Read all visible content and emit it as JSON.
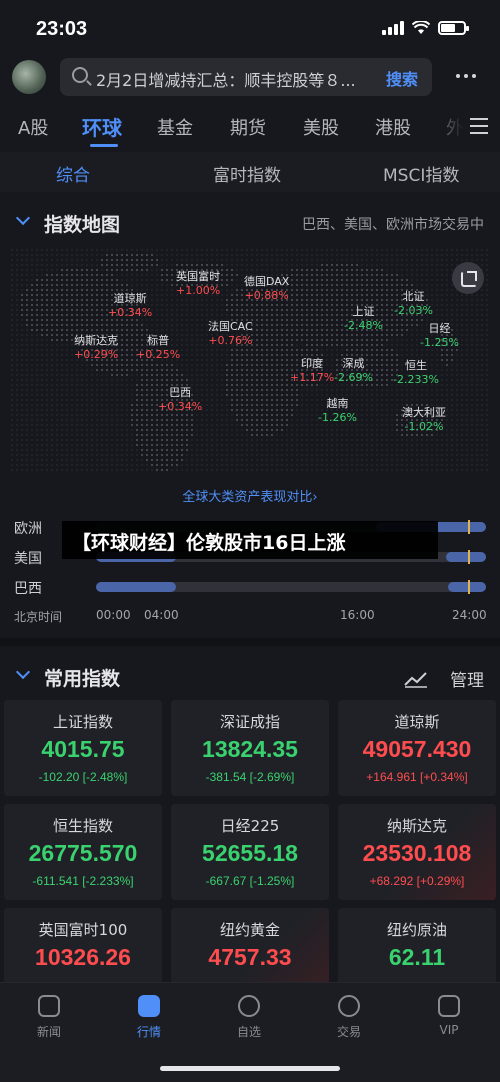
{
  "status_bar": {
    "time": "23:03"
  },
  "search": {
    "text": "2月2日增减持汇总：顺丰控股等８...",
    "button": "搜索"
  },
  "main_tabs": [
    {
      "label": "A股"
    },
    {
      "label": "环球"
    },
    {
      "label": "基金"
    },
    {
      "label": "期货"
    },
    {
      "label": "美股"
    },
    {
      "label": "港股"
    },
    {
      "label": "外"
    }
  ],
  "active_main_tab": "环球",
  "sub_tabs": [
    {
      "label": "综合"
    },
    {
      "label": "富时指数"
    },
    {
      "label": "MSCI指数"
    }
  ],
  "index_map": {
    "title": "指数地图",
    "note": "巴西、美国、欧洲市场交易中",
    "markers": [
      {
        "name": "英国富时",
        "value": "+1.00%",
        "dir": "up"
      },
      {
        "name": "德国DAX",
        "value": "+0.88%",
        "dir": "up"
      },
      {
        "name": "道琼斯",
        "value": "+0.34%",
        "dir": "up"
      },
      {
        "name": "法国CAC",
        "value": "+0.76%",
        "dir": "up"
      },
      {
        "name": "上证",
        "value": "-2.48%",
        "dir": "down"
      },
      {
        "name": "北证",
        "value": "-2.03%",
        "dir": "down"
      },
      {
        "name": "日经",
        "value": "-1.25%",
        "dir": "down"
      },
      {
        "name": "纳斯达克",
        "value": "+0.29%",
        "dir": "up"
      },
      {
        "name": "标普",
        "value": "+0.25%",
        "dir": "up"
      },
      {
        "name": "印度",
        "value": "+1.17%",
        "dir": "up"
      },
      {
        "name": "深成",
        "value": "-2.69%",
        "dir": "down"
      },
      {
        "name": "恒生",
        "value": "-2.233%",
        "dir": "down"
      },
      {
        "name": "巴西",
        "value": "+0.34%",
        "dir": "up"
      },
      {
        "name": "越南",
        "value": "-1.26%",
        "dir": "down"
      },
      {
        "name": "澳大利亚",
        "value": "-1.02%",
        "dir": "down"
      }
    ],
    "compare_link": "全球大类资产表现对比"
  },
  "sessions": {
    "rows": [
      {
        "name": "欧洲"
      },
      {
        "name": "美国"
      },
      {
        "name": "巴西"
      }
    ],
    "axis_title": "北京时间",
    "ticks": [
      "00:00",
      "04:00",
      "16:00",
      "24:00"
    ]
  },
  "news_banner": "【环球财经】伦敦股市16日上涨",
  "common": {
    "title": "常用指数",
    "manage": "管理",
    "cards": [
      {
        "name": "上证指数",
        "price": "4015.75",
        "change": "-102.20 [-2.48%]",
        "dir": "down"
      },
      {
        "name": "深证成指",
        "price": "13824.35",
        "change": "-381.54 [-2.69%]",
        "dir": "down"
      },
      {
        "name": "道琼斯",
        "price": "49057.430",
        "change": "+164.961 [+0.34%]",
        "dir": "up"
      },
      {
        "name": "恒生指数",
        "price": "26775.570",
        "change": "-611.541 [-2.233%]",
        "dir": "down"
      },
      {
        "name": "日经225",
        "price": "52655.18",
        "change": "-667.67 [-1.25%]",
        "dir": "down"
      },
      {
        "name": "纳斯达克",
        "price": "23530.108",
        "change": "+68.292 [+0.29%]",
        "dir": "up"
      },
      {
        "name": "英国富时100",
        "price": "10326.26",
        "change": "",
        "dir": "up"
      },
      {
        "name": "纽约黄金",
        "price": "4757.33",
        "change": "",
        "dir": "up"
      },
      {
        "name": "纽约原油",
        "price": "62.11",
        "change": "",
        "dir": "down"
      }
    ]
  },
  "bottom_nav": [
    {
      "label": "新闻",
      "icon": "news-icon"
    },
    {
      "label": "行情",
      "icon": "chart-icon"
    },
    {
      "label": "自选",
      "icon": "plus-icon"
    },
    {
      "label": "交易",
      "icon": "exchange-icon"
    },
    {
      "label": "VIP",
      "icon": "vip-icon"
    }
  ],
  "active_nav": "行情"
}
